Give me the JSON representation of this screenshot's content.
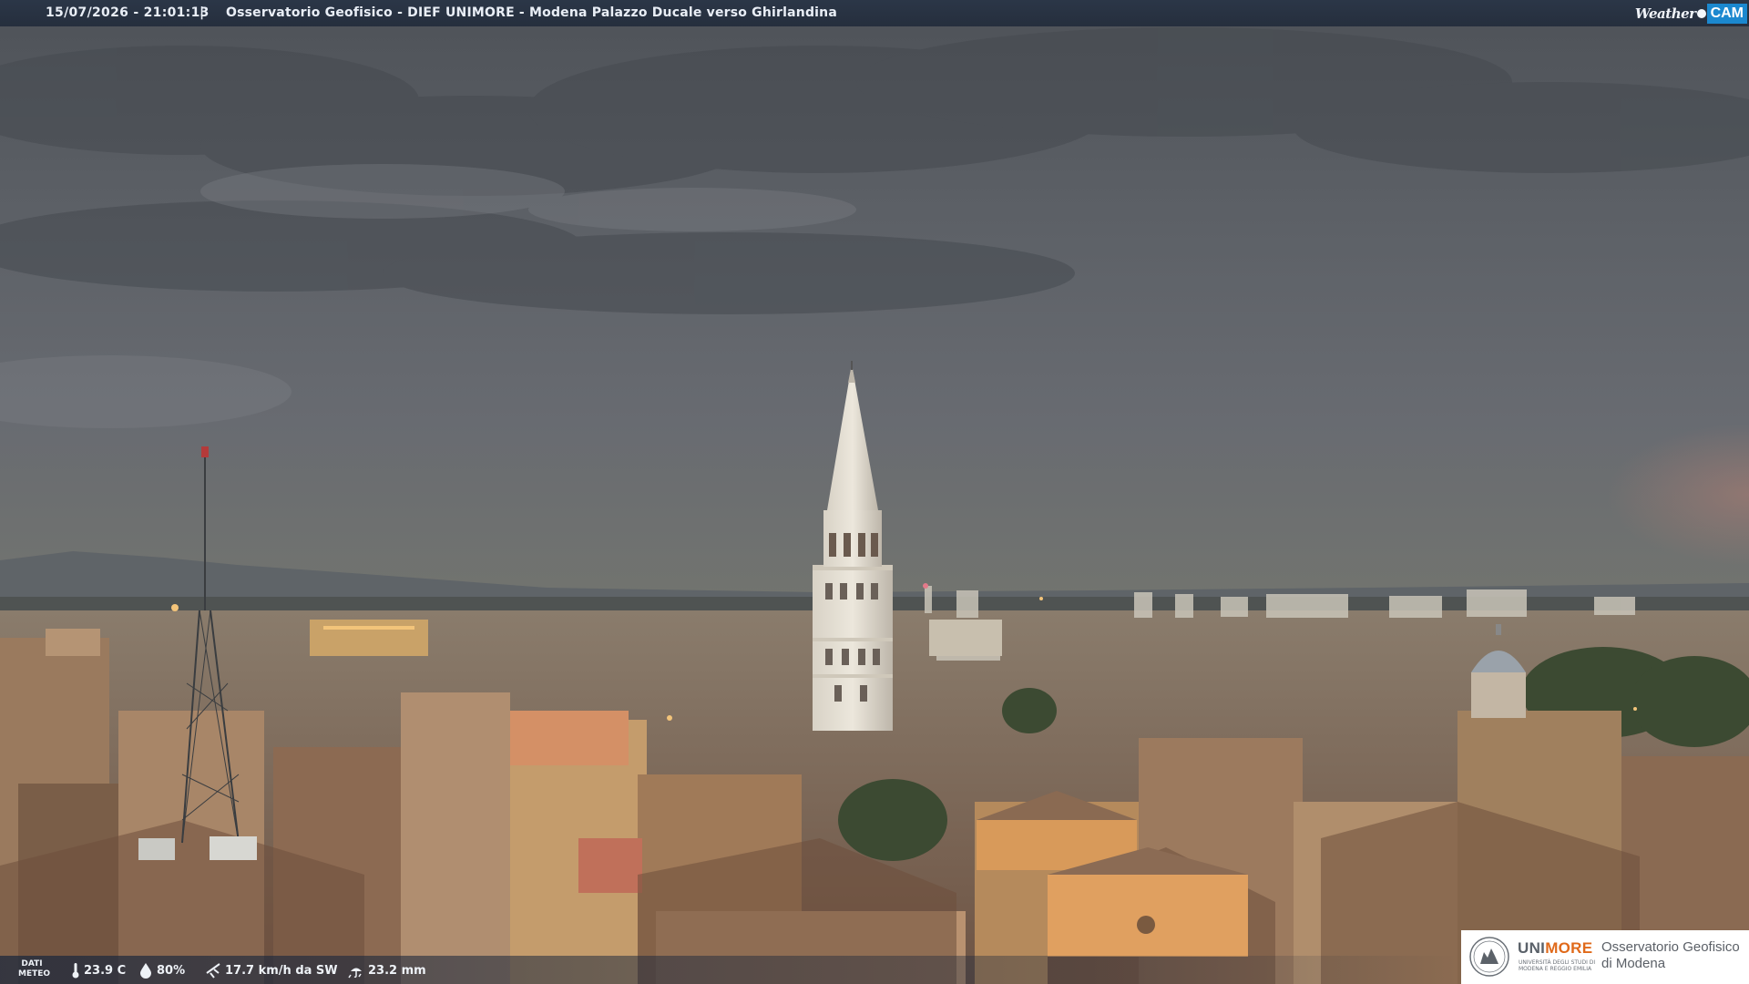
{
  "overlay": {
    "timestamp": "15/07/2026 - 21:01:13",
    "separator": "|",
    "title": "Osservatorio Geofisico - DIEF UNIMORE - Modena Palazzo Ducale verso Ghirlandina"
  },
  "brand": {
    "weather_text": "Weather",
    "cam_text": "CAM"
  },
  "weather_data": {
    "label": "DATI METEO",
    "temperature": "23.9 C",
    "humidity": "80%",
    "wind": "17.7 km/h da SW",
    "rain": "23.2 mm",
    "icons": [
      "thermometer-icon",
      "humidity-drop-icon",
      "wind-icon",
      "rain-icon"
    ]
  },
  "logo": {
    "uni_part1": "UNI",
    "uni_part2": "MORE",
    "university_line1": "UNIVERSITÀ DEGLI STUDI DI",
    "university_line2": "MODENA E REGGIO EMILIA",
    "observatory_line1": "Osservatorio Geofisico",
    "observatory_line2": "di Modena"
  },
  "colors": {
    "sky": "#5d6168",
    "roofs": "#8a6a52",
    "tower": "#e6e0d4",
    "uni_orange": "#e06a1b",
    "cam_blue": "#1b88cf"
  }
}
